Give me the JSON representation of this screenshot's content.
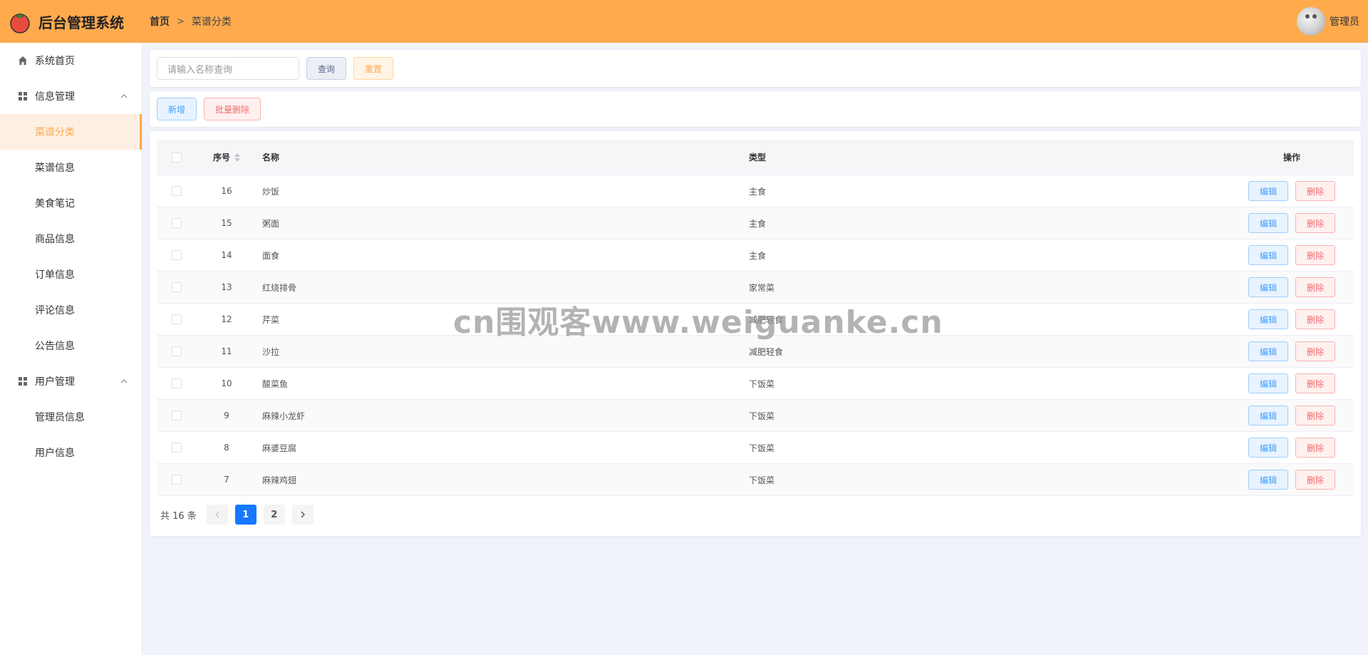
{
  "app": {
    "title": "后台管理系统",
    "logo_icon": "tomato-icon",
    "accent_color": "#ffaa4d"
  },
  "breadcrumb": {
    "home": "首页",
    "separator": ">",
    "current": "菜谱分类"
  },
  "user": {
    "name": "管理员",
    "avatar_icon": "cat-avatar"
  },
  "sidebar": {
    "home": "系统首页",
    "groups": [
      {
        "label": "信息管理",
        "icon": "grid-icon",
        "items": [
          "菜谱分类",
          "菜谱信息",
          "美食笔记",
          "商品信息",
          "订单信息",
          "评论信息",
          "公告信息"
        ]
      },
      {
        "label": "用户管理",
        "icon": "grid-icon",
        "items": [
          "管理员信息",
          "用户信息"
        ]
      }
    ],
    "active": "菜谱分类"
  },
  "search": {
    "placeholder": "请输入名称查询",
    "query_label": "查询",
    "reset_label": "重置"
  },
  "actions": {
    "add_label": "新增",
    "batch_delete_label": "批量删除"
  },
  "table": {
    "headers": {
      "index": "序号",
      "name": "名称",
      "type": "类型",
      "operation": "操作"
    },
    "edit_label": "编辑",
    "delete_label": "删除",
    "rows": [
      {
        "id": "16",
        "name": "炒饭",
        "type": "主食"
      },
      {
        "id": "15",
        "name": "粥面",
        "type": "主食"
      },
      {
        "id": "14",
        "name": "面食",
        "type": "主食"
      },
      {
        "id": "13",
        "name": "红烧排骨",
        "type": "家常菜"
      },
      {
        "id": "12",
        "name": "芹菜",
        "type": "减肥轻食"
      },
      {
        "id": "11",
        "name": "沙拉",
        "type": "减肥轻食"
      },
      {
        "id": "10",
        "name": "酸菜鱼",
        "type": "下饭菜"
      },
      {
        "id": "9",
        "name": "麻辣小龙虾",
        "type": "下饭菜"
      },
      {
        "id": "8",
        "name": "麻婆豆腐",
        "type": "下饭菜"
      },
      {
        "id": "7",
        "name": "麻辣鸡翅",
        "type": "下饭菜"
      }
    ]
  },
  "pagination": {
    "total_text": "共 16 条",
    "pages": [
      "1",
      "2"
    ],
    "current_page": "1",
    "prev_icon": "chevron-left-icon",
    "next_icon": "chevron-right-icon"
  },
  "watermark": "cn围观客www.weiguanke.cn"
}
